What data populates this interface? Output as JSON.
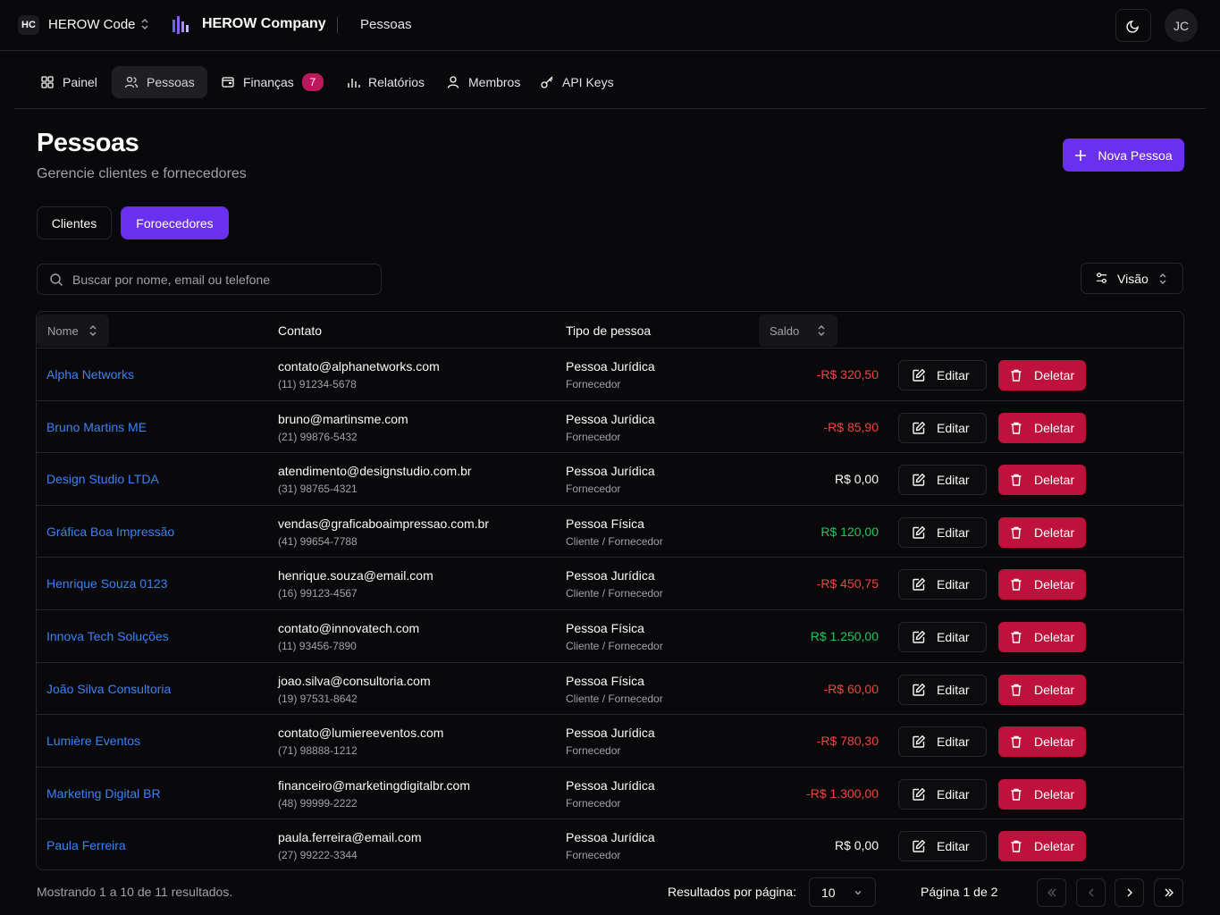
{
  "topbar": {
    "org_badge": "HC",
    "org_name": "HEROW Code",
    "company_name": "HEROW Company",
    "current_page": "Pessoas",
    "avatar_initials": "JC"
  },
  "nav": {
    "items": [
      {
        "label": "Painel",
        "icon": "grid-icon"
      },
      {
        "label": "Pessoas",
        "icon": "users-icon"
      },
      {
        "label": "Finanças",
        "icon": "wallet-icon",
        "badge": "7"
      },
      {
        "label": "Relatórios",
        "icon": "bar-chart-icon"
      },
      {
        "label": "Membros",
        "icon": "user-icon"
      },
      {
        "label": "API Keys",
        "icon": "key-icon"
      }
    ]
  },
  "header": {
    "title": "Pessoas",
    "subtitle": "Gerencie clientes e fornecedores",
    "new_button": "Nova Pessoa"
  },
  "tabs": {
    "clients": "Clientes",
    "suppliers": "Foroecedores"
  },
  "search": {
    "placeholder": "Buscar por nome, email ou telefone"
  },
  "view_button": "Visão",
  "table": {
    "columns": {
      "name": "Nome",
      "contact": "Contato",
      "type": "Tipo de pessoa",
      "balance": "Saldo"
    },
    "edit_label": "Editar",
    "delete_label": "Deletar",
    "rows": [
      {
        "name": "Alpha Networks",
        "email": "contato@alphanetworks.com",
        "phone": "(11) 91234-5678",
        "type": "Pessoa Jurídica",
        "role": "Fornecedor",
        "balance": "-R$ 320,50",
        "sign": "neg"
      },
      {
        "name": "Bruno Martins ME",
        "email": "bruno@martinsme.com",
        "phone": "(21) 99876-5432",
        "type": "Pessoa Jurídica",
        "role": "Fornecedor",
        "balance": "-R$ 85,90",
        "sign": "neg"
      },
      {
        "name": "Design Studio LTDA",
        "email": "atendimento@designstudio.com.br",
        "phone": "(31) 98765-4321",
        "type": "Pessoa Jurídica",
        "role": "Fornecedor",
        "balance": "R$ 0,00",
        "sign": "zero"
      },
      {
        "name": "Gráfica Boa Impressão",
        "email": "vendas@graficaboaimpressao.com.br",
        "phone": "(41) 99654-7788",
        "type": "Pessoa Física",
        "role": "Cliente / Fornecedor",
        "balance": "R$ 120,00",
        "sign": "pos"
      },
      {
        "name": "Henrique Souza 0123",
        "email": "henrique.souza@email.com",
        "phone": "(16) 99123-4567",
        "type": "Pessoa Jurídica",
        "role": "Cliente / Fornecedor",
        "balance": "-R$ 450,75",
        "sign": "neg"
      },
      {
        "name": "Innova Tech Soluções",
        "email": "contato@innovatech.com",
        "phone": "(11) 93456-7890",
        "type": "Pessoa Física",
        "role": "Cliente / Fornecedor",
        "balance": "R$ 1.250,00",
        "sign": "pos"
      },
      {
        "name": "João Silva Consultoria",
        "email": "joao.silva@consultoria.com",
        "phone": "(19) 97531-8642",
        "type": "Pessoa Física",
        "role": "Cliente / Fornecedor",
        "balance": "-R$ 60,00",
        "sign": "neg"
      },
      {
        "name": "Lumière Eventos",
        "email": "contato@lumiereeventos.com",
        "phone": "(71) 98888-1212",
        "type": "Pessoa Jurídica",
        "role": "Fornecedor",
        "balance": "-R$ 780,30",
        "sign": "neg"
      },
      {
        "name": "Marketing Digital BR",
        "email": "financeiro@marketingdigitalbr.com",
        "phone": "(48) 99999-2222",
        "type": "Pessoa Jurídica",
        "role": "Fornecedor",
        "balance": "-R$ 1.300,00",
        "sign": "neg"
      },
      {
        "name": "Paula Ferreira",
        "email": "paula.ferreira@email.com",
        "phone": "(27) 99222-3344",
        "type": "Pessoa Jurídica",
        "role": "Fornecedor",
        "balance": "R$ 0,00",
        "sign": "zero"
      }
    ]
  },
  "footer": {
    "showing": "Mostrando 1 a 10 de 11 resultados.",
    "per_page_label": "Resultados por página:",
    "per_page_value": "10",
    "page_info": "Página 1 de 2"
  },
  "colors": {
    "accent": "#6b2ff0",
    "danger": "#be123c",
    "link": "#3b82f6",
    "negative": "#ef4444",
    "positive": "#22c55e",
    "badge": "#be185d"
  }
}
